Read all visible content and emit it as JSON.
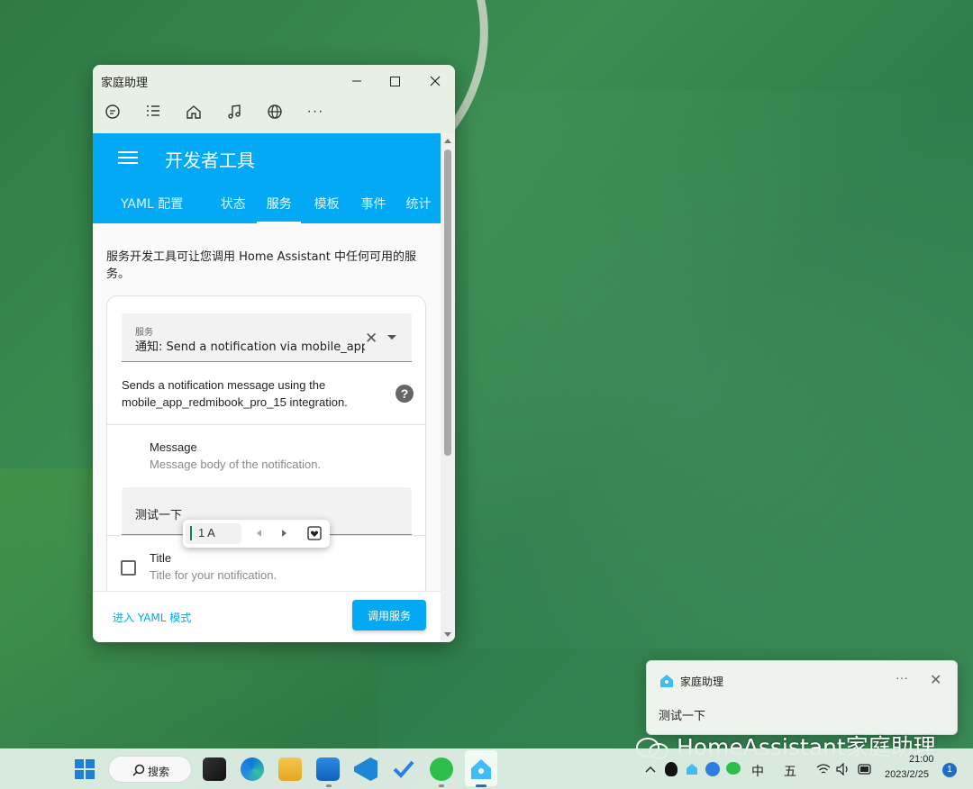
{
  "window": {
    "title": "家庭助理"
  },
  "toolbar": {
    "icons": [
      "chat-icon",
      "list-icon",
      "home-icon",
      "music-icon",
      "globe-icon",
      "more-icon"
    ],
    "more_glyph": "···"
  },
  "appbar": {
    "title": "开发者工具",
    "tabs": [
      "YAML 配置",
      "状态",
      "服务",
      "模板",
      "事件",
      "统计"
    ],
    "active_tab": "服务"
  },
  "intro": "服务开发工具可让您调用 Home Assistant 中任何可用的服务。",
  "service": {
    "label": "服务",
    "value": "通知: Send a notification via mobile_app_r",
    "description": "Sends a notification message using the mobile_app_redmibook_pro_15 integration."
  },
  "fields": {
    "message": {
      "name": "Message",
      "hint": "Message body of the notification.",
      "value": "测试一下"
    },
    "title": {
      "name": "Title",
      "hint": "Title for your notification."
    }
  },
  "ime": {
    "text": "1 A"
  },
  "footer": {
    "yaml_link": "进入 YAML 模式",
    "call_button": "调用服务"
  },
  "toast": {
    "app": "家庭助理",
    "body": "测试一下",
    "more": "···"
  },
  "watermark": "HomeAssistant家庭助理",
  "taskbar": {
    "search": "搜索",
    "ime_mode": "中",
    "ime_input": "五",
    "time": "21:00",
    "date": "2023/2/25",
    "notification_count": "1"
  },
  "colors": {
    "accent": "#03a9f4",
    "wallpaper": "#3b8d52"
  }
}
